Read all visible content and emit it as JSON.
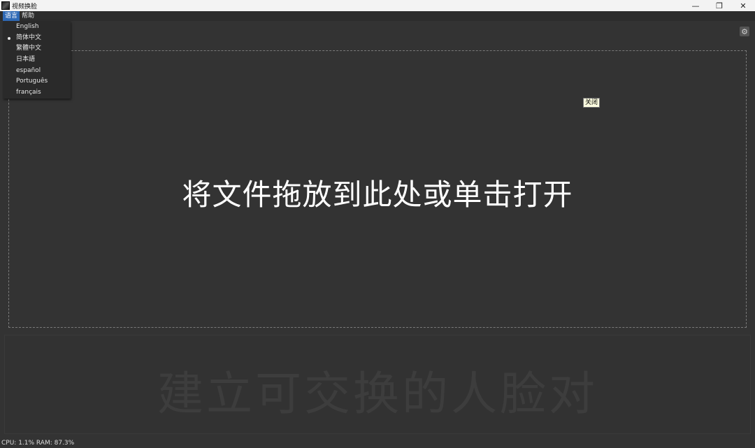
{
  "window": {
    "title": "视频换脸",
    "controls": {
      "minimize": "—",
      "restore": "❐",
      "close": "✕"
    }
  },
  "menubar": {
    "items": [
      {
        "label": "语言",
        "active": true
      },
      {
        "label": "帮助",
        "active": false
      }
    ]
  },
  "language_menu": {
    "selected": "简体中文",
    "items": [
      "English",
      "简体中文",
      "繁體中文",
      "日本語",
      "español",
      "Português",
      "français"
    ]
  },
  "settings": {
    "icon": "gear-icon",
    "glyph": "⚙"
  },
  "dropzone": {
    "prompt": "将文件拖放到此处或单击打开",
    "tooltip": "关闭"
  },
  "bottom_panel": {
    "placeholder": "建立可交换的人脸对"
  },
  "status": {
    "text": "CPU: 1.1% RAM: 87.3%"
  },
  "colors": {
    "background": "#333333",
    "menu_active": "#2f6ab6",
    "tooltip_bg": "#ffffe1"
  }
}
